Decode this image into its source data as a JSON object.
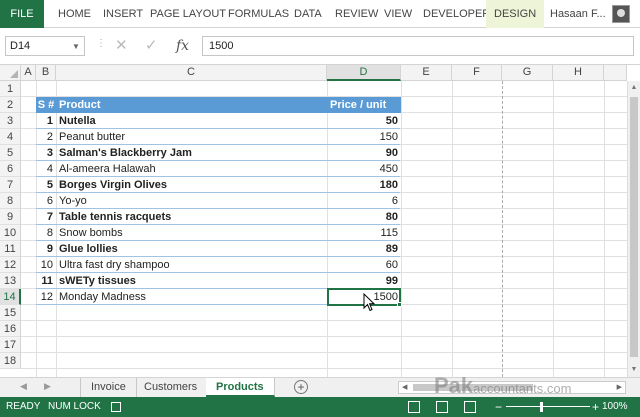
{
  "ribbon": {
    "file": "FILE",
    "tabs": [
      "HOME",
      "INSERT",
      "PAGE LAYOUT",
      "FORMULAS",
      "DATA",
      "REVIEW",
      "VIEW",
      "DEVELOPER",
      "DESIGN"
    ],
    "user": "Hasaan F..."
  },
  "formula_bar": {
    "name_box": "D14",
    "fx": "fx",
    "value": "1500"
  },
  "columns": [
    "A",
    "B",
    "C",
    "D",
    "E",
    "F",
    "G",
    "H"
  ],
  "rows": [
    "1",
    "2",
    "3",
    "4",
    "5",
    "6",
    "7",
    "8",
    "9",
    "10",
    "11",
    "12",
    "13",
    "14",
    "15",
    "16",
    "17",
    "18"
  ],
  "table": {
    "headers": {
      "num": "S #",
      "product": "Product",
      "price": "Price / unit"
    },
    "items": [
      {
        "n": "1",
        "product": "Nutella",
        "price": "50",
        "bold": true
      },
      {
        "n": "2",
        "product": "Peanut butter",
        "price": "150",
        "bold": false
      },
      {
        "n": "3",
        "product": "Salman's Blackberry Jam",
        "price": "90",
        "bold": true
      },
      {
        "n": "4",
        "product": "Al-ameera Halawah",
        "price": "450",
        "bold": false
      },
      {
        "n": "5",
        "product": "Borges Virgin Olives",
        "price": "180",
        "bold": true
      },
      {
        "n": "6",
        "product": "Yo-yo",
        "price": "6",
        "bold": false
      },
      {
        "n": "7",
        "product": "Table tennis racquets",
        "price": "80",
        "bold": true
      },
      {
        "n": "8",
        "product": "Snow bombs",
        "price": "115",
        "bold": false
      },
      {
        "n": "9",
        "product": "Glue lollies",
        "price": "89",
        "bold": true
      },
      {
        "n": "10",
        "product": "Ultra fast dry shampoo",
        "price": "60",
        "bold": false
      },
      {
        "n": "11",
        "product": "sWETy tissues",
        "price": "99",
        "bold": true
      },
      {
        "n": "12",
        "product": "Monday Madness",
        "price": "1500",
        "bold": false
      }
    ]
  },
  "sheets": {
    "tabs": [
      "Invoice",
      "Customers",
      "Products"
    ],
    "active": "Products"
  },
  "watermark": {
    "main": "Pak",
    "sub": "accountants.com"
  },
  "status": {
    "ready": "READY",
    "numlock": "NUM LOCK",
    "zoom_out": "−",
    "zoom_in": "+",
    "zoom": "100%"
  },
  "colors": {
    "excel_green": "#217346",
    "table_header": "#5b9bd5",
    "table_border": "#9dc3e6"
  }
}
